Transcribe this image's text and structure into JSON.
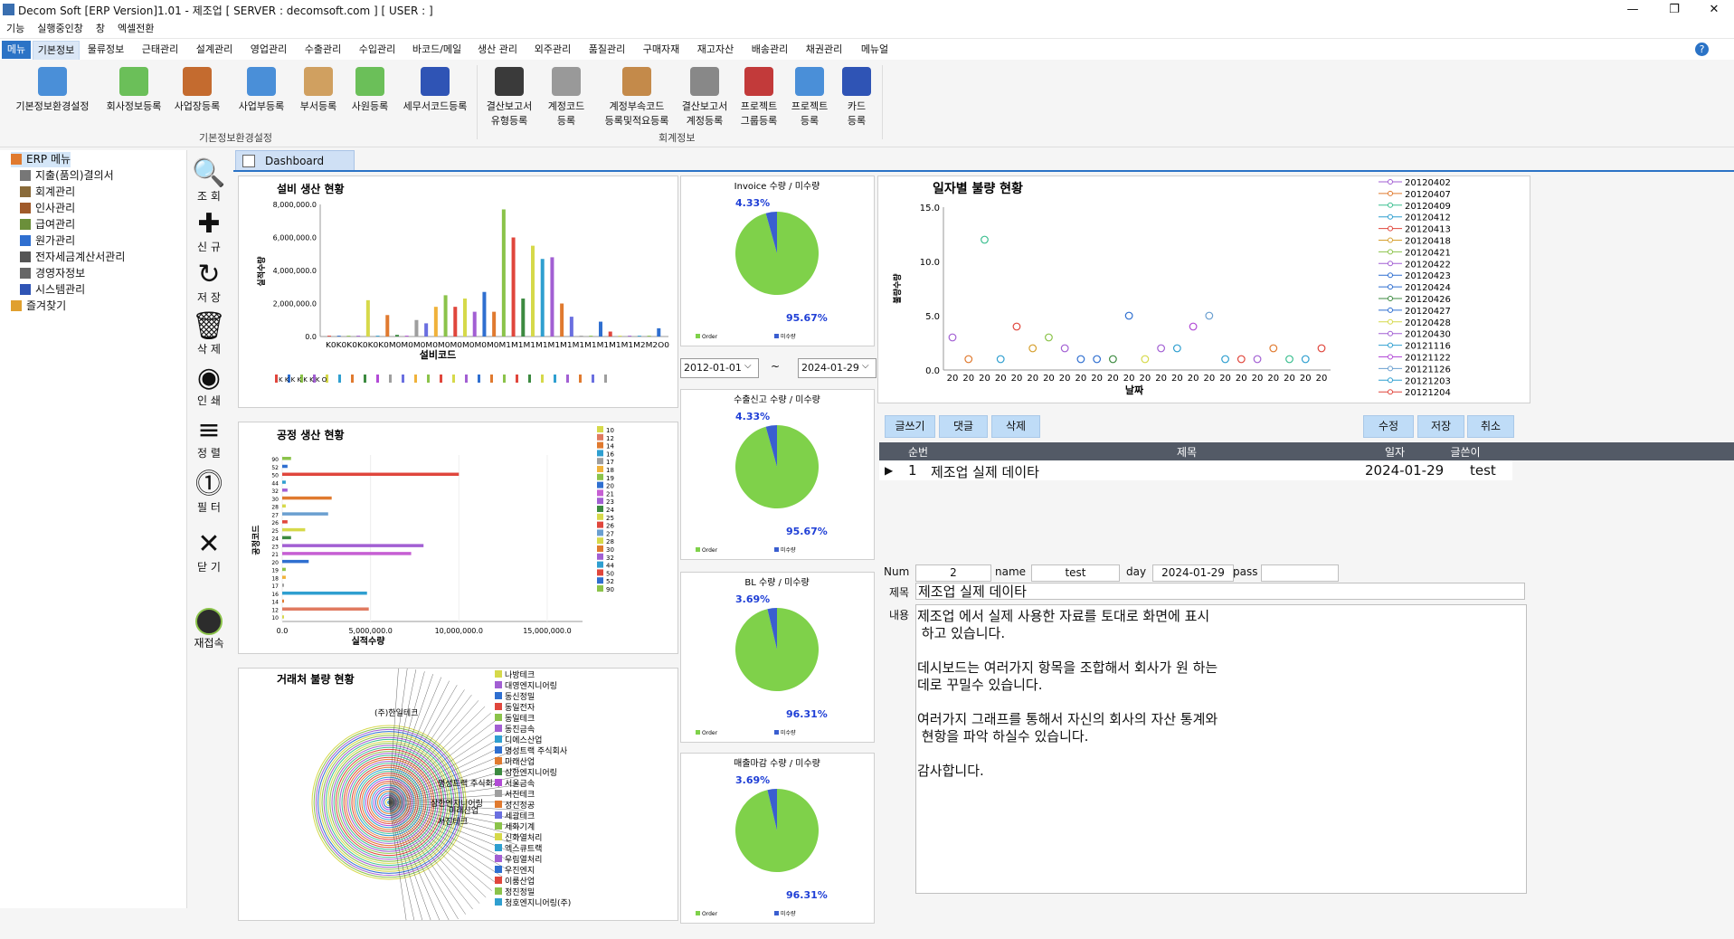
{
  "window": {
    "title": "Decom Soft [ERP Version]1.01 - 제조업  [ SERVER : decomsoft.com ]  [ USER :  ]",
    "controls": [
      "—",
      "❐",
      "✕"
    ]
  },
  "menubar": [
    "기능",
    "실행중인창",
    "창",
    "엑셀전환"
  ],
  "tabs": [
    "메뉴",
    "기본정보",
    "물류정보",
    "근태관리",
    "설계관리",
    "영업관리",
    "수출관리",
    "수입관리",
    "바코드/메일",
    "생산 관리",
    "외주관리",
    "품질관리",
    "구매자재",
    "재고자산",
    "배송관리",
    "채권관리",
    "메뉴얼"
  ],
  "ribbon": {
    "group1": {
      "label": "기본정보환경설정",
      "items": [
        "기본정보환경설정",
        "회사정보등록",
        "사업장등록",
        "사업부등록",
        "부서등록",
        "사원등록",
        "세무서코드등록"
      ]
    },
    "group2": {
      "label": "회계정보",
      "items": [
        [
          "결산보고서",
          "유형등록"
        ],
        [
          "계정코드",
          "등록"
        ],
        [
          "계정부속코드",
          "등록및적요등록"
        ],
        [
          "결산보고서",
          "계정등록"
        ],
        [
          "프로젝트",
          "그룹등록"
        ],
        [
          "프로젝트",
          "등록"
        ],
        [
          "카드",
          "등록"
        ]
      ]
    }
  },
  "tree": [
    "ERP 메뉴",
    "지출(품의)결의서",
    "회계관리",
    "인사관리",
    "급여관리",
    "원가관리",
    "전자세금계산서관리",
    "경영자정보",
    "시스템관리",
    "즐겨찾기"
  ],
  "toolbar": {
    "search": "조 회",
    "new": "신 규",
    "save": "저 장",
    "delete": "삭 제",
    "print": "인 쇄",
    "sort": "정 렬",
    "filter": "필 터",
    "close": "닫 기",
    "reconnect": "재접속"
  },
  "dashboard": {
    "tab": "Dashboard",
    "date_from": "2012-01-01",
    "tilde": "~",
    "date_to": "2024-01-29"
  },
  "chart_data": [
    {
      "type": "bar",
      "title": "설비 생산 현황",
      "xlabel": "설비코드",
      "ylabel": "실적수량",
      "ylim": [
        0,
        8000000
      ],
      "yticks": [
        "8,000,000.0",
        "6,000,000.0",
        "4,000,000.0",
        "2,000,000.0",
        "0.0"
      ],
      "xticks": "K0K0K0K0K0K0M0M0M0M0M0M0M0M0M0M1M1M1M1M1M1M1M1M1M1M1M2M2O0",
      "legend_marks": "K K K K K K K          O",
      "values": [
        0.05,
        0.05,
        0.05,
        0.05,
        2.2,
        0.05,
        1.3,
        0.1,
        0.05,
        1.0,
        0.8,
        1.8,
        2.5,
        1.8,
        2.3,
        1.5,
        2.7,
        1.5,
        7.7,
        6.0,
        2.3,
        5.5,
        4.7,
        4.8,
        2.0,
        1.2,
        0.05,
        0.05,
        0.9,
        0.3,
        0.05,
        0.05,
        0.05,
        0.05,
        0.5
      ],
      "colors": [
        "#e0463c",
        "#2f6fd0",
        "#8bc34a",
        "#a25fd3",
        "#d6d94a",
        "#2f9fd0",
        "#e07a2f",
        "#3c8a40",
        "#b24ad6",
        "#9e9e9e",
        "#6a6fe0",
        "#f0b23a",
        "#8bc34a",
        "#e0463c",
        "#d6d94a",
        "#a25fd3",
        "#2f6fd0",
        "#e07a2f",
        "#8bc34a",
        "#e0463c",
        "#3c8a40",
        "#d6d94a",
        "#2f9fd0",
        "#a25fd3",
        "#e07a2f",
        "#6a6fe0",
        "#9e9e9e",
        "#8bc34a",
        "#2f6fd0",
        "#e0463c",
        "#d6d94a",
        "#a25fd3",
        "#2f9fd0",
        "#8bc34a",
        "#2f6fd0"
      ]
    },
    {
      "type": "bar",
      "orientation": "horizontal",
      "title": "공정 생산 현황",
      "xlabel": "실적수량",
      "ylabel": "공정코드",
      "xlim": [
        0,
        17000000
      ],
      "xticks": [
        "0.0",
        "5,000,000.0",
        "10,000,000.0",
        "15,000,000.0"
      ],
      "yticks": [
        "90",
        "52",
        "50",
        "44",
        "32",
        "30",
        "28",
        "27",
        "26",
        "25",
        "24",
        "23",
        "21",
        "20",
        "19",
        "18",
        "17",
        "16",
        "14",
        "12",
        "10"
      ],
      "legend": [
        "10",
        "12",
        "14",
        "16",
        "17",
        "18",
        "19",
        "20",
        "21",
        "23",
        "24",
        "25",
        "26",
        "27",
        "28",
        "30",
        "32",
        "44",
        "50",
        "52",
        "90"
      ],
      "values": [
        0.5,
        0.3,
        10.0,
        0.2,
        0.3,
        2.8,
        0.2,
        2.6,
        0.3,
        1.3,
        0.5,
        8.0,
        7.3,
        1.5,
        0.2,
        0.2,
        0.1,
        4.8,
        0.1,
        4.9,
        0.1
      ],
      "colors": [
        "#8bc34a",
        "#2f6fd0",
        "#e0463c",
        "#2f9fd0",
        "#a25fd3",
        "#e07a2f",
        "#d6d94a",
        "#6a9fd0",
        "#e0463c",
        "#d6d94a",
        "#3c8a40",
        "#a25fd3",
        "#c65fd3",
        "#2f6fd0",
        "#8bc34a",
        "#f0b23a",
        "#9e9e9e",
        "#2f9fd0",
        "#e07a2f",
        "#e07a60",
        "#d6d94a"
      ]
    },
    {
      "type": "pie",
      "title": "거래처 불량 현황",
      "legend": [
        "나방테크",
        "대영엔지니어링",
        "동신정밀",
        "동일전자",
        "동일테크",
        "동진금속",
        "디에스산업",
        "명성트랙 주식회사",
        "미래산업",
        "삼한엔지니어링",
        "서울금속",
        "서진테크",
        "성신정공",
        "세광테크",
        "세화기계",
        "신화열처리",
        "엑스큐트랙",
        "우림열처리",
        "우진엔지",
        "이룸산업",
        "정진정밀",
        "청호엔지니어링(주)"
      ],
      "legend_colors": [
        "#d6d94a",
        "#a25fd3",
        "#2f6fd0",
        "#e0463c",
        "#8bc34a",
        "#a25fd3",
        "#2f9fd0",
        "#2f6fd0",
        "#e07a2f",
        "#3c8a40",
        "#b24ad6",
        "#9e9e9e",
        "#e07a2f",
        "#6a6fe0",
        "#8bc34a",
        "#d6d94a",
        "#2f9fd0",
        "#a25fd3",
        "#2f6fd0",
        "#e0463c",
        "#8bc34a",
        "#2f9fd0"
      ],
      "callout_labels": [
        "(주)한일테크",
        "명성트랙 주식회사",
        "미래산업",
        "삼한엔지니어링",
        "서진테크"
      ]
    },
    {
      "type": "pie",
      "title": "Invoice 수량 / 미수량",
      "values": [
        95.67,
        4.33
      ],
      "labels": [
        "95.67%",
        "4.33%"
      ],
      "legend": [
        "Order",
        "미수량"
      ],
      "colors": [
        "#7fd14a",
        "#3a5ed0"
      ]
    },
    {
      "type": "pie",
      "title": "수출신고 수량 / 미수량",
      "values": [
        95.67,
        4.33
      ],
      "labels": [
        "95.67%",
        "4.33%"
      ],
      "legend": [
        "Order",
        "미수량"
      ],
      "colors": [
        "#7fd14a",
        "#3a5ed0"
      ]
    },
    {
      "type": "pie",
      "title": "BL 수량 / 미수량",
      "values": [
        96.31,
        3.69
      ],
      "labels": [
        "96.31%",
        "3.69%"
      ],
      "legend": [
        "Order",
        "미수량"
      ],
      "colors": [
        "#7fd14a",
        "#3a5ed0"
      ]
    },
    {
      "type": "pie",
      "title": "매출마감 수량 / 미수량",
      "values": [
        96.31,
        3.69
      ],
      "labels": [
        "96.31%",
        "3.69%"
      ],
      "legend": [
        "Order",
        "미수량"
      ],
      "colors": [
        "#7fd14a",
        "#3a5ed0"
      ]
    },
    {
      "type": "scatter",
      "title": "일자별 불량 현황",
      "xlabel": "날짜",
      "ylabel": "불량수량",
      "ylim": [
        0,
        15
      ],
      "yticks": [
        "15.0",
        "10.0",
        "5.0",
        "0.0"
      ],
      "xtick_label": "20",
      "xtick_count": 24,
      "points": [
        [
          0,
          3
        ],
        [
          1,
          1
        ],
        [
          2,
          12
        ],
        [
          3,
          1
        ],
        [
          4,
          4
        ],
        [
          5,
          2
        ],
        [
          6,
          3
        ],
        [
          7,
          2
        ],
        [
          8,
          1
        ],
        [
          9,
          1
        ],
        [
          10,
          1
        ],
        [
          11,
          5
        ],
        [
          12,
          1
        ],
        [
          13,
          2
        ],
        [
          14,
          2
        ],
        [
          15,
          4
        ],
        [
          16,
          5
        ],
        [
          17,
          1
        ],
        [
          18,
          1
        ],
        [
          19,
          1
        ],
        [
          20,
          2
        ],
        [
          21,
          1
        ],
        [
          22,
          1
        ],
        [
          23,
          2
        ]
      ],
      "legend": [
        "20120402",
        "20120407",
        "20120409",
        "20120412",
        "20120413",
        "20120418",
        "20120421",
        "20120422",
        "20120423",
        "20120424",
        "20120426",
        "20120427",
        "20120428",
        "20120430",
        "20121116",
        "20121122",
        "20121126",
        "20121203",
        "20121204"
      ],
      "colors": [
        "#a25fd3",
        "#e07a2f",
        "#3cbf90",
        "#2f9fd0",
        "#e0463c",
        "#d6a02f",
        "#8bc34a",
        "#a25fd3",
        "#2f6fd0",
        "#2f6fd0",
        "#3c8a40",
        "#2f6fd0",
        "#d6d94a",
        "#a25fd3",
        "#2f9fd0",
        "#b24ad6",
        "#6a9fd0",
        "#2f9fd0",
        "#e0463c"
      ]
    }
  ],
  "board": {
    "buttons_left": [
      "글쓰기",
      "댓글",
      "삭제"
    ],
    "buttons_right": [
      "수정",
      "저장",
      "취소"
    ],
    "columns": [
      "순번",
      "제목",
      "일자",
      "글쓴이"
    ],
    "row": {
      "marker": "▶",
      "num": "1",
      "title": "제조업 실제 데이타",
      "date": "2024-01-29",
      "writer": "test"
    },
    "form": {
      "num_label": "Num",
      "num_value": "2",
      "name_label": "name",
      "name_value": "test",
      "day_label": "day",
      "day_value": "2024-01-29",
      "pass_label": "pass",
      "pass_value": "",
      "subject_label": "제목",
      "subject_value": "제조업 실제 데이타",
      "content_label": "내용",
      "content_lines": [
        "제조업 에서 실제 사용한 자료를 토대로 화면에 표시",
        " 하고 있습니다.",
        "",
        "데시보드는 여러가지 항목을 조합해서 회사가 원 하는",
        "데로 꾸밀수 있습니다.",
        "",
        "여러가지 그래프를 통해서 자신의 회사의 자산 통계와",
        " 현항을 파악 하실수 있습니다.",
        "",
        "감사합니다."
      ]
    }
  }
}
